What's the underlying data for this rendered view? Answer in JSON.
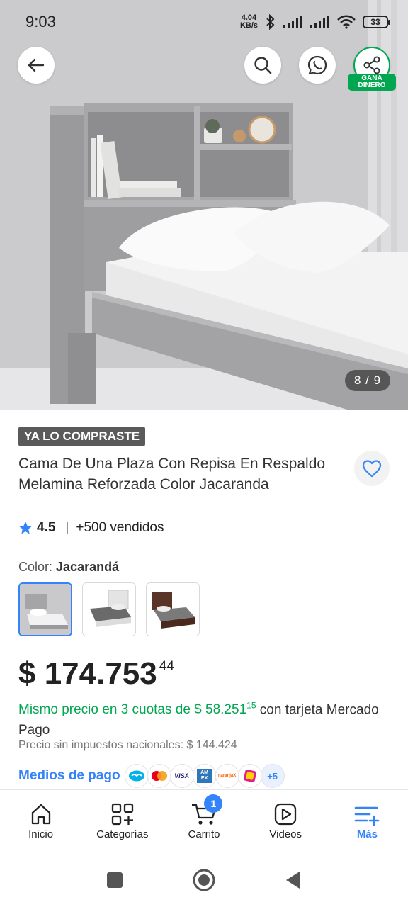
{
  "status_bar": {
    "time": "9:03",
    "net_speed_value": "4.04",
    "net_speed_unit": "KB/s",
    "battery": "33"
  },
  "hero": {
    "image_counter": "8 / 9",
    "share_badge_line1": "GANA",
    "share_badge_line2": "DINERO",
    "icons": [
      "back-arrow-icon",
      "search-icon",
      "whatsapp-icon",
      "share-icon"
    ]
  },
  "product": {
    "purchased_tag": "YA LO COMPRASTE",
    "title": "Cama De Una Plaza Con Repisa En Respaldo Melamina Reforzada Color Jacaranda",
    "rating": "4.5",
    "rating_separator": "|",
    "sold": "+500 vendidos",
    "color_label": "Color:",
    "color_value": "Jacarandá",
    "color_options_count": 3,
    "price_main": "$ 174.753",
    "price_cents": "44",
    "installments_prefix": "Mismo precio en 3 cuotas de $ 58.251",
    "installments_cents": "15",
    "installments_suffix": " con tarjeta Mercado Pago",
    "price_without_taxes": "Precio sin impuestos nacionales: $ 144.424",
    "payment_methods_label": "Medios de pago",
    "payment_more": "+5",
    "visa_label": "VISA",
    "amex_label": "AM EX",
    "naranja_label": "naranjaX"
  },
  "bottom_nav": {
    "items": [
      {
        "label": "Inicio",
        "icon": "home-icon"
      },
      {
        "label": "Categorías",
        "icon": "categories-icon"
      },
      {
        "label": "Carrito",
        "icon": "cart-icon"
      },
      {
        "label": "Videos",
        "icon": "video-icon"
      },
      {
        "label": "Más",
        "icon": "menu-plus-icon"
      }
    ],
    "cart_count": "1",
    "active": "Más"
  },
  "colors": {
    "accent_blue": "#3483fa",
    "green": "#00a650",
    "tag_gray": "#5a5a5a"
  }
}
